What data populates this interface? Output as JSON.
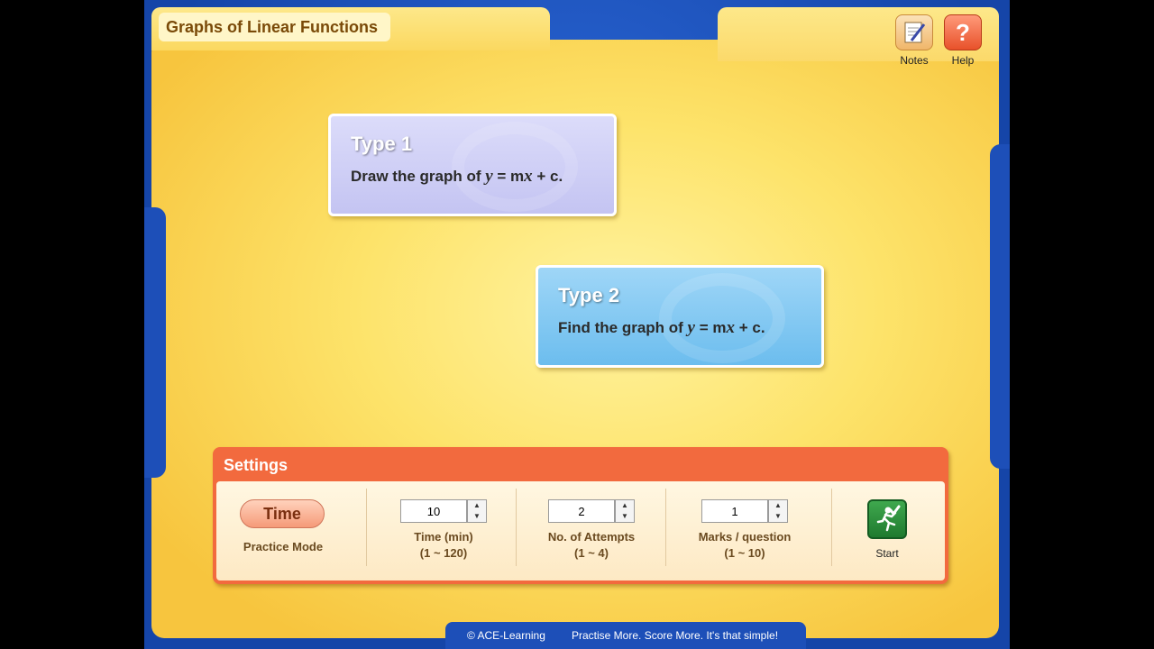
{
  "app": {
    "title": "Graphs of Linear Functions"
  },
  "toolbar": {
    "notes_label": "Notes",
    "help_label": "Help",
    "help_glyph": "?"
  },
  "types": [
    {
      "title": "Type 1",
      "desc_prefix": "Draw the graph of ",
      "y": "y",
      "eq": " = m",
      "x": "x",
      "tail": " + c."
    },
    {
      "title": "Type 2",
      "desc_prefix": "Find the graph of ",
      "y": "y",
      "eq": " = m",
      "x": "x",
      "tail": " + c."
    }
  ],
  "settings": {
    "title": "Settings",
    "mode_button": "Time",
    "mode_label": "Practice Mode",
    "time": {
      "value": "10",
      "label": "Time (min)",
      "range": "(1 ~ 120)"
    },
    "attempts": {
      "value": "2",
      "label": "No. of Attempts",
      "range": "(1 ~ 4)"
    },
    "marks": {
      "value": "1",
      "label": "Marks / question",
      "range": "(1 ~ 10)"
    },
    "start_label": "Start"
  },
  "footer": {
    "copyright": "© ACE-Learning",
    "slogan": "Practise More. Score More. It's that simple!"
  },
  "colors": {
    "frame": "#1d4fb8",
    "panel": "#fde36a",
    "settings_header": "#f26a3e",
    "type1": "#c4c4f2",
    "type2": "#6cbdee",
    "start": "#1f7a2e"
  },
  "icons": [
    "notes-icon",
    "help-icon",
    "start-icon",
    "spin-up-icon",
    "spin-down-icon"
  ]
}
